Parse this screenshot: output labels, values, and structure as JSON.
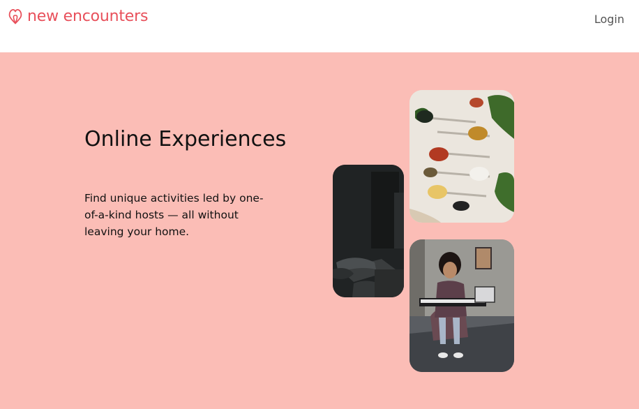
{
  "header": {
    "brand": "new encounters",
    "logo_icon": "airbnb-belo-icon",
    "login_label": "Login"
  },
  "hero": {
    "title": "Online Experiences",
    "subtitle": "Find unique activities led by one-of-a-kind hosts — all without leaving your home."
  },
  "colors": {
    "brand": "#e8505b",
    "hero_background": "#fbbdb6",
    "header_background": "#ffffff"
  }
}
